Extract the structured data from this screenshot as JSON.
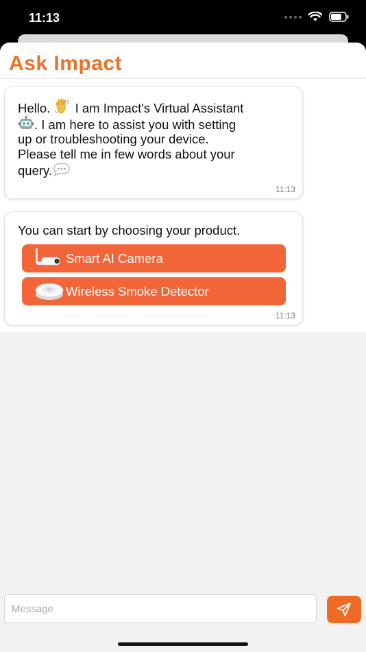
{
  "status_bar": {
    "time": "11:13"
  },
  "header": {
    "title": "Ask Impact"
  },
  "messages": [
    {
      "lines": [
        {
          "before": "Hello. ",
          "emoji": "waving-hand-icon",
          "after": " I am Impact's Virtual Assistant"
        },
        {
          "emoji": "robot-icon",
          "after": ". I am here to assist you with setting"
        },
        {
          "after": "up or troubleshooting your device."
        },
        {
          "after": "Please tell me in few words about your"
        },
        {
          "before": "query.",
          "emoji": "speech-bubble-icon"
        }
      ],
      "time": "11:13"
    },
    {
      "prompt": "You can start by choosing your product.",
      "options": [
        {
          "label": "Smart AI Camera",
          "icon": "camera-icon"
        },
        {
          "label": "Wireless Smoke Detector",
          "icon": "smoke-detector-icon"
        }
      ],
      "time": "11:13"
    }
  ],
  "composer": {
    "placeholder": "Message",
    "send_icon": "send-icon"
  },
  "colors": {
    "accent": "#ee7127",
    "button": "#f26539",
    "send": "#ee6a25",
    "background": "#f2f2f2"
  }
}
